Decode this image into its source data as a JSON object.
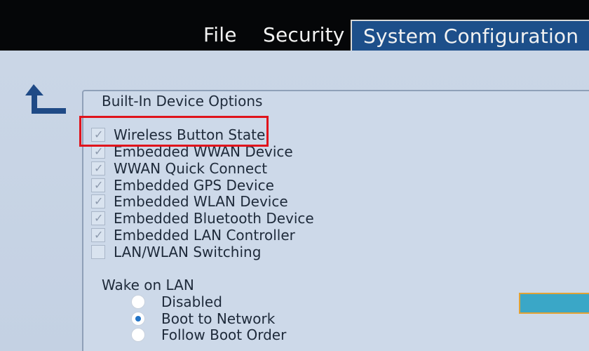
{
  "menu": {
    "tabs": [
      {
        "label": "File"
      },
      {
        "label": "Security"
      },
      {
        "label": "System Configuration"
      }
    ],
    "active_tab": "System Configuration"
  },
  "icons": {
    "back": "back-arrow-icon",
    "check": "checkmark-icon"
  },
  "panel": {
    "title": "Built-In Device Options",
    "options": [
      {
        "label": "Wireless Button State",
        "checked": true
      },
      {
        "label": "Embedded WWAN Device",
        "checked": true
      },
      {
        "label": "WWAN Quick Connect",
        "checked": true
      },
      {
        "label": "Embedded GPS Device",
        "checked": true
      },
      {
        "label": "Embedded WLAN Device",
        "checked": true
      },
      {
        "label": "Embedded Bluetooth Device",
        "checked": true
      },
      {
        "label": "Embedded LAN Controller",
        "checked": true
      },
      {
        "label": "LAN/WLAN Switching",
        "checked": false
      }
    ],
    "check_glyph": "✓",
    "wake_on_lan": {
      "title": "Wake on LAN",
      "choices": [
        {
          "label": "Disabled",
          "selected": false
        },
        {
          "label": "Boot to Network",
          "selected": true
        },
        {
          "label": "Follow Boot Order",
          "selected": false
        }
      ]
    }
  },
  "highlight": {
    "target": "Wireless Button State",
    "color": "#e0141c"
  },
  "colors": {
    "menubar": "#050608",
    "active_tab": "#1d4f8a",
    "content_bg": "#c8d4e5",
    "radio_dot": "#2274c7",
    "side_button": "#3aa7c7",
    "side_button_border": "#e1a235"
  }
}
